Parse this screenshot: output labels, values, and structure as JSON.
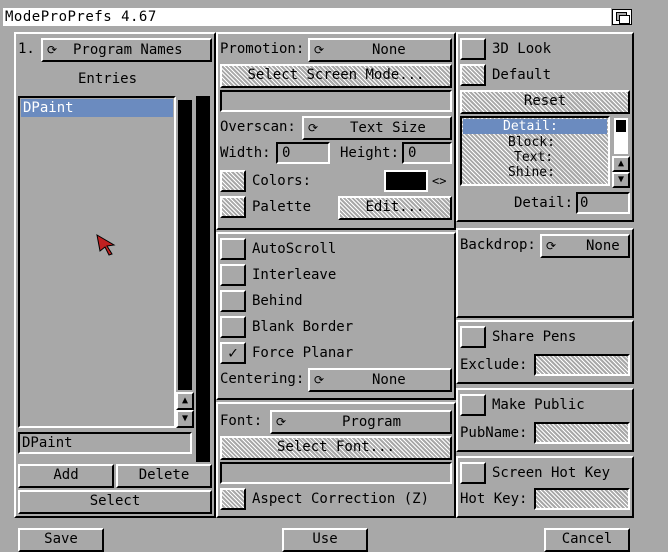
{
  "window": {
    "title": "ModeProPrefs 4.67"
  },
  "left": {
    "number": "1.",
    "program_names_cycle": "Program Names",
    "entries_label": "Entries",
    "list_items": [
      "DPaint"
    ],
    "entry_field": "DPaint",
    "add_label": "Add",
    "delete_label": "Delete",
    "select_label": "Select"
  },
  "middle": {
    "promotion_label": "Promotion:",
    "promotion_value": "None",
    "select_screen_mode_label": "Select Screen Mode...",
    "screen_mode_field": "",
    "overscan_label": "Overscan:",
    "overscan_value": "Text Size",
    "width_label": "Width:",
    "width_value": "0",
    "height_label": "Height:",
    "height_value": "0",
    "colors_label": "Colors:",
    "colors_arrow": "<>",
    "palette_label": "Palette",
    "edit_label": "Edit...",
    "options": [
      {
        "label": "AutoScroll",
        "checked": false
      },
      {
        "label": "Interleave",
        "checked": false
      },
      {
        "label": "Behind",
        "checked": false
      },
      {
        "label": "Blank Border",
        "checked": false
      },
      {
        "label": "Force Planar",
        "checked": true
      }
    ],
    "centering_label": "Centering:",
    "centering_value": "None",
    "font_label": "Font:",
    "font_value": "Program",
    "select_font_label": "Select Font...",
    "font_field": "",
    "aspect_label": "Aspect Correction (Z)"
  },
  "right": {
    "look3d_label": "3D Look",
    "default_label": "Default",
    "reset_label": "Reset",
    "pen_list": [
      "Detail:",
      "Block:",
      "Text:",
      "Shine:"
    ],
    "detail_label": "Detail:",
    "detail_value": "0",
    "backdrop_label": "Backdrop:",
    "backdrop_value": "None",
    "share_pens_label": "Share Pens",
    "exclude_label": "Exclude:",
    "make_public_label": "Make Public",
    "pubname_label": "PubName:",
    "hotkey_toggle_label": "Screen Hot Key",
    "hotkey_label": "Hot Key:"
  },
  "bottom": {
    "save_label": "Save",
    "use_label": "Use",
    "cancel_label": "Cancel"
  },
  "colors": {
    "bg": "#a8a8a8",
    "highlight": "#6b8bbf",
    "white": "#ffffff",
    "black": "#000000"
  }
}
